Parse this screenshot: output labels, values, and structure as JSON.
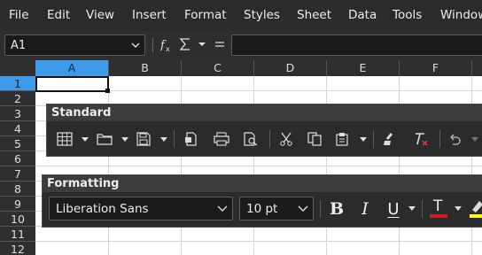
{
  "menubar": {
    "items": [
      "File",
      "Edit",
      "View",
      "Insert",
      "Format",
      "Styles",
      "Sheet",
      "Data",
      "Tools",
      "Window"
    ]
  },
  "formula_bar": {
    "name_box": "A1",
    "function_wizard_icon": "fx-icon",
    "sum_icon": "sigma-icon",
    "equals_icon": "=",
    "formula": ""
  },
  "sheet": {
    "columns": [
      "A",
      "B",
      "C",
      "D",
      "E",
      "F"
    ],
    "rows": [
      "1",
      "2",
      "3",
      "4",
      "5",
      "6",
      "7",
      "8",
      "9",
      "10",
      "11",
      "12"
    ],
    "selected_cell": "A1"
  },
  "toolbars": {
    "standard": {
      "title": "Standard",
      "buttons": [
        "table-icon",
        "open-folder-icon",
        "save-icon",
        "export-pdf-icon",
        "print-icon",
        "print-preview-icon",
        "cut-icon",
        "copy-icon",
        "paste-icon",
        "clone-formatting-icon",
        "clear-formatting-icon",
        "undo-icon"
      ]
    },
    "formatting": {
      "title": "Formatting",
      "font_name": "Liberation Sans",
      "font_size": "10 pt",
      "buttons": [
        "bold-icon",
        "italic-icon",
        "underline-icon",
        "font-color-icon",
        "highlight-icon"
      ],
      "bold_glyph": "B",
      "italic_glyph": "I",
      "underline_glyph": "U",
      "font_color_glyph": "T"
    }
  },
  "colors": {
    "accent": "#3d9be9",
    "font_color": "#c9211e",
    "highlight": "#ffff00",
    "clear_format_x": "#e04040"
  }
}
